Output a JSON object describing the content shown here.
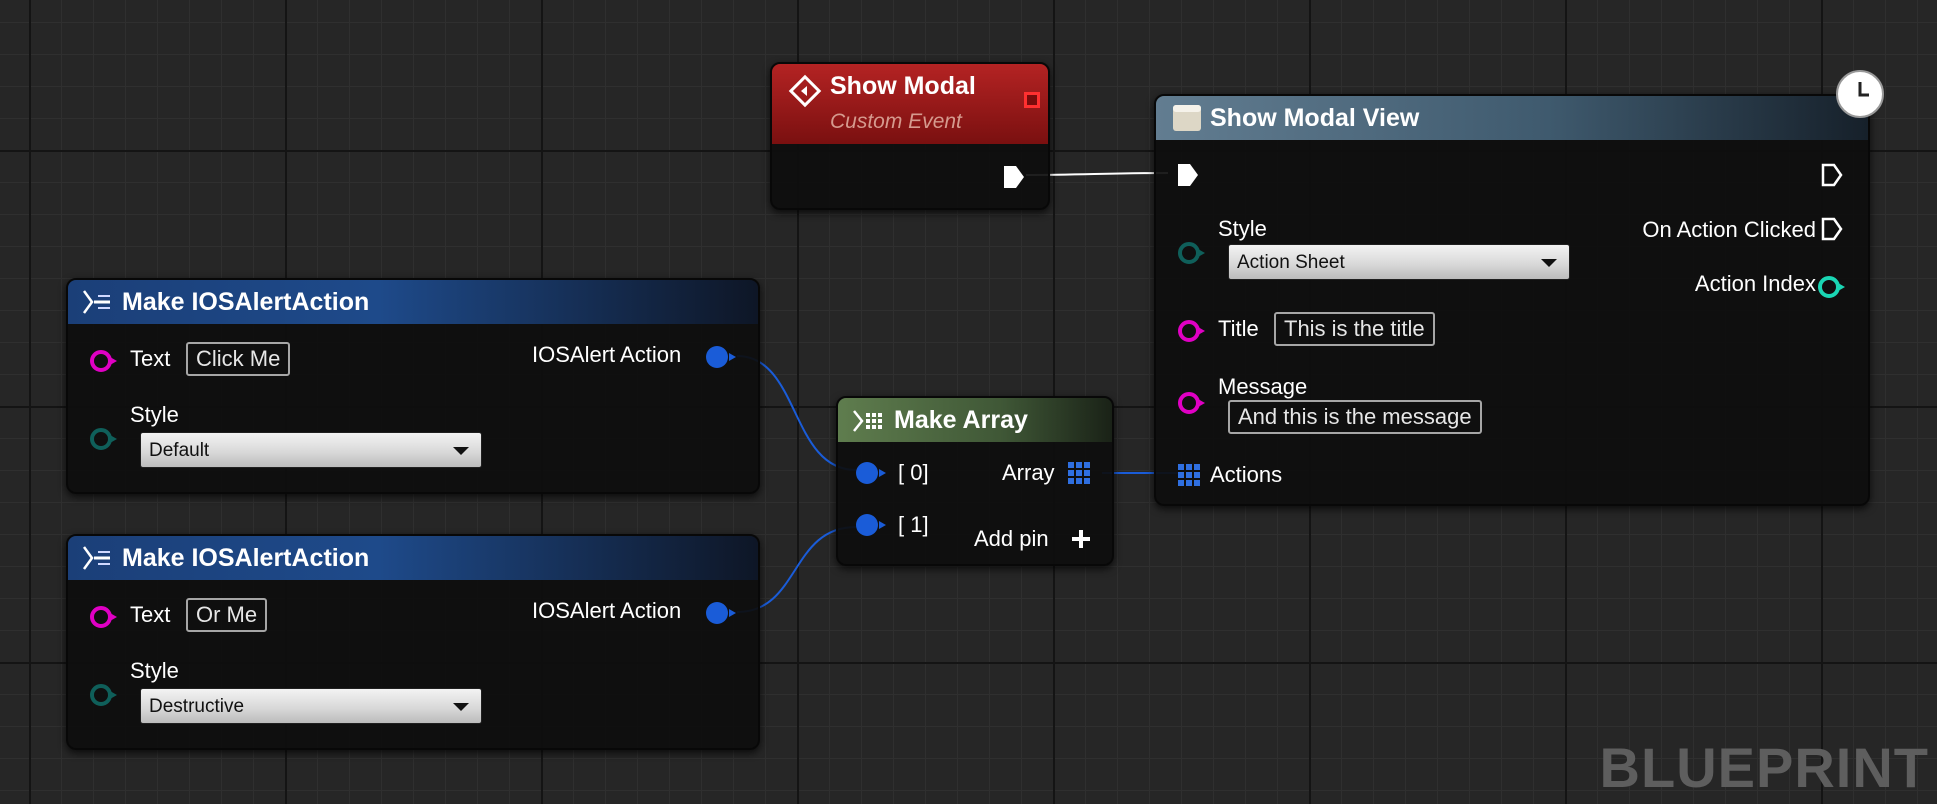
{
  "colors": {
    "exec_wire": "#ffffff",
    "struct_pin": "#1a5cd8",
    "text_pin": "#e000c4",
    "enum_pin": "#0f5f5a",
    "int_pin": "#1ad6b4"
  },
  "watermark": "BLUEPRINT",
  "show_modal": {
    "icon": "custom-event-diamond-icon",
    "title": "Show Modal",
    "subtitle": "Custom Event"
  },
  "show_modal_view": {
    "icon": "function-icon",
    "title": "Show Modal View",
    "style_label": "Style",
    "style_value": "Action Sheet",
    "title_label": "Title",
    "title_value": "This is the title",
    "message_label": "Message",
    "message_value": "And this is the message",
    "actions_label": "Actions",
    "on_action_clicked_label": "On Action Clicked",
    "action_index_label": "Action Index",
    "latent_icon": "clock-icon"
  },
  "make_array": {
    "icon": "make-array-icon",
    "title": "Make Array",
    "pin0_label": "[ 0]",
    "pin1_label": "[ 1]",
    "array_label": "Array",
    "add_pin_label": "Add pin",
    "add_pin_icon": "plus-icon"
  },
  "alert_action_1": {
    "icon": "make-struct-icon",
    "title": "Make IOSAlertAction",
    "text_label": "Text",
    "text_value": "Click Me",
    "style_label": "Style",
    "style_value": "Default",
    "output_label": "IOSAlert Action"
  },
  "alert_action_2": {
    "icon": "make-struct-icon",
    "title": "Make IOSAlertAction",
    "text_label": "Text",
    "text_value": "Or Me",
    "style_label": "Style",
    "style_value": "Destructive",
    "output_label": "IOSAlert Action"
  }
}
